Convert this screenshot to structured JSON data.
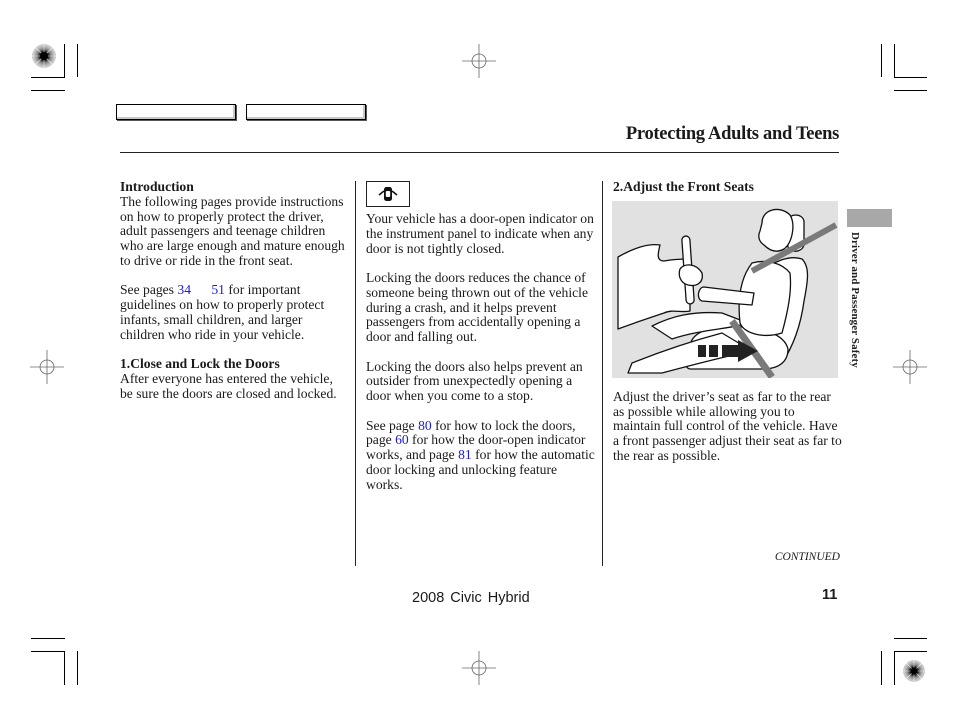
{
  "header": {
    "nav_buttons": [
      {
        "label": ""
      },
      {
        "label": ""
      }
    ],
    "title": "Protecting Adults and Teens"
  },
  "columns": {
    "left": {
      "intro_heading": "Introduction",
      "intro_text": "The following pages provide instructions on how to properly protect the driver, adult passengers and teenage children who are large enough and mature enough to drive or ride in the front seat.",
      "see_pages_prefix": "See pages ",
      "see_pages_link_start": "34",
      "see_pages_link_end": "51",
      "see_pages_suffix": " for important guidelines on how to properly protect infants, small children, and larger children who ride in your vehicle.",
      "step1_heading": "1.Close and Lock the Doors",
      "step1_text": "After everyone has entered the vehicle, be sure the doors are closed and locked."
    },
    "middle": {
      "indicator_icon": "door-open-indicator-icon",
      "para1": "Your vehicle has a door-open indicator on the instrument panel to indicate when any door is not tightly closed.",
      "para2": "Locking the doors reduces the chance of someone being thrown out of the vehicle during a crash, and it helps prevent passengers from accidentally opening a door and falling out.",
      "para3": "Locking the doors also helps prevent an outsider from unexpectedly opening a door when you come to a stop.",
      "ref_part1": "See page ",
      "ref_link1": "80",
      "ref_part2": " for how to lock the doors, page ",
      "ref_link2": "60",
      "ref_part3": " for how the door-open indicator works, and page ",
      "ref_link3": "81",
      "ref_part4": " for how the automatic door locking and unlocking feature works."
    },
    "right": {
      "step2_heading": "2.Adjust the Front Seats",
      "figure_alt": "Driver seated upright with seat belt, arrow showing seat moving rearward",
      "step2_text": "Adjust the driver’s seat as far to the rear as possible while allowing you to maintain full control of the vehicle. Have a front passenger adjust their seat as far to the rear as possible."
    }
  },
  "sidebar": {
    "section_label": "Driver and Passenger Safety"
  },
  "footer": {
    "continued": "CONTINUED",
    "model": "2008  Civic  Hybrid",
    "page_number": "11"
  },
  "colors": {
    "link": "#1a1adc",
    "figure_bg": "#e1e1e1",
    "side_tab": "#a8a8a8"
  }
}
